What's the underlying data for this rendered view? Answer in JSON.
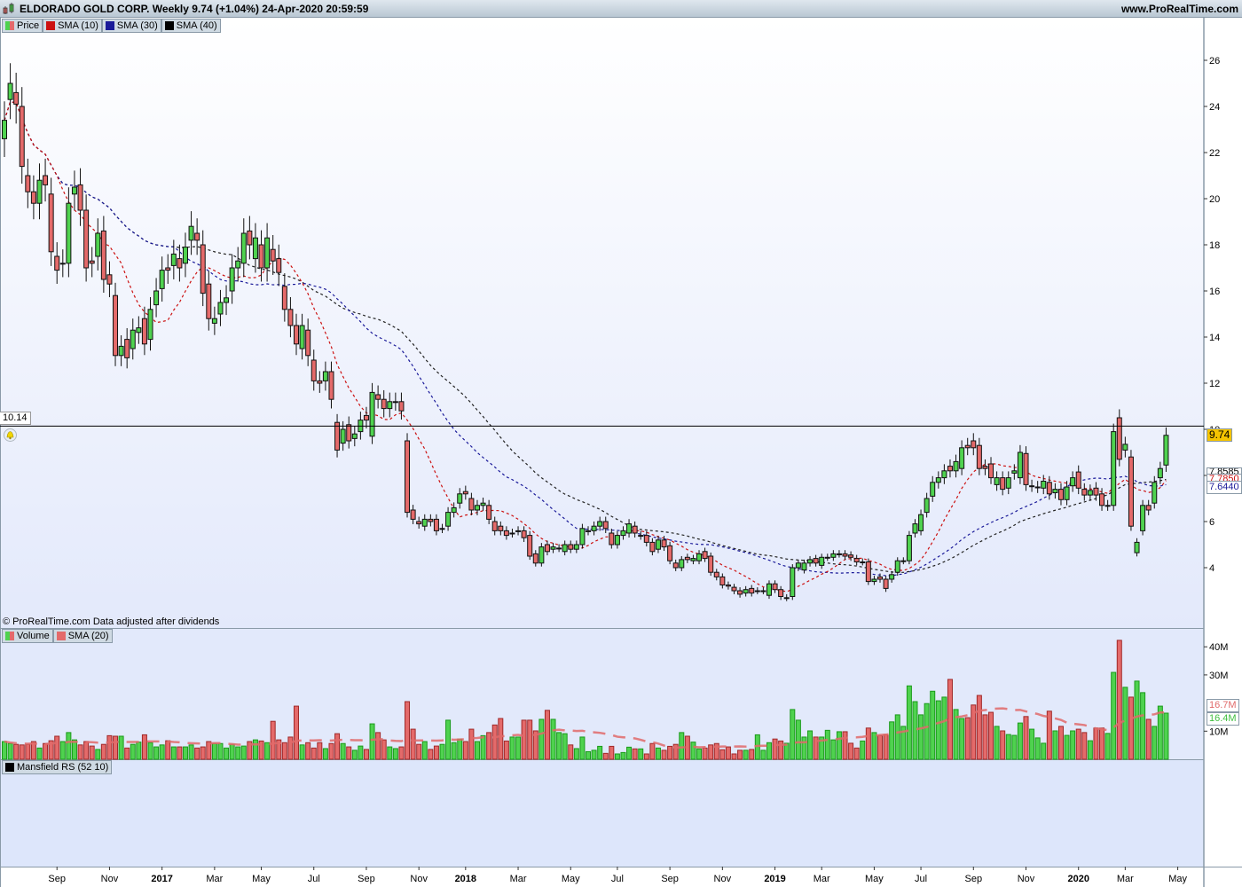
{
  "header": {
    "title": "ELDORADO GOLD CORP. Weekly 9.74 (+1.04%) 24-Apr-2020 20:59:59",
    "site": "www.ProRealTime.com"
  },
  "price_legend": [
    "Price",
    "SMA (10)",
    "SMA (30)",
    "SMA (40)"
  ],
  "volume_legend": [
    "Volume",
    "SMA (20)"
  ],
  "rs_legend": [
    "Mansfield RS (52 10)"
  ],
  "footnote": "© ProRealTime.com  Data adjusted after dividends",
  "colors": {
    "up": "#4fd24f",
    "down": "#e46a6a",
    "sma10": "#cc1111",
    "sma30": "#1a1a99",
    "sma40": "#222222",
    "vol_sma": "#e06a6a",
    "last_price_bg": "#f5c400"
  },
  "markers": {
    "line_value": "10.14",
    "last_price": "9.74",
    "sma40_last": "7.8585",
    "sma10_last": "7.7850",
    "sma30_last": "7.6440",
    "vol_sma_last": "16.7M",
    "vol_last": "16.4M"
  },
  "chart_data": {
    "type": "candlestick",
    "title": "ELDORADO GOLD CORP. Weekly",
    "price_axis": {
      "ticks": [
        4,
        6,
        8,
        10,
        12,
        14,
        16,
        18,
        20,
        22,
        24,
        26
      ],
      "ylim": [
        1.5,
        27.8
      ]
    },
    "volume_axis": {
      "ticks": [
        {
          "v": 10,
          "label": "10M"
        },
        {
          "v": 30,
          "label": "30M"
        },
        {
          "v": 40,
          "label": "40M"
        }
      ],
      "unit": "M"
    },
    "x_ticks": [
      {
        "week": 9,
        "label": "Sep"
      },
      {
        "week": 18,
        "label": "Nov"
      },
      {
        "week": 27,
        "label": "2017",
        "bold": true
      },
      {
        "week": 36,
        "label": "Mar"
      },
      {
        "week": 44,
        "label": "May"
      },
      {
        "week": 53,
        "label": "Jul"
      },
      {
        "week": 62,
        "label": "Sep"
      },
      {
        "week": 71,
        "label": "Nov"
      },
      {
        "week": 79,
        "label": "2018",
        "bold": true
      },
      {
        "week": 88,
        "label": "Mar"
      },
      {
        "week": 97,
        "label": "May"
      },
      {
        "week": 105,
        "label": "Jul"
      },
      {
        "week": 114,
        "label": "Sep"
      },
      {
        "week": 123,
        "label": "Nov"
      },
      {
        "week": 132,
        "label": "2019",
        "bold": true
      },
      {
        "week": 140,
        "label": "Mar"
      },
      {
        "week": 149,
        "label": "May"
      },
      {
        "week": 157,
        "label": "Jul"
      },
      {
        "week": 166,
        "label": "Sep"
      },
      {
        "week": 175,
        "label": "Nov"
      },
      {
        "week": 184,
        "label": "2020",
        "bold": true
      },
      {
        "week": 192,
        "label": "Mar"
      },
      {
        "week": 201,
        "label": "May"
      }
    ],
    "candles_open_close": [
      [
        22.6,
        23.4
      ],
      [
        24.3,
        25.0
      ],
      [
        24.6,
        24.1
      ],
      [
        24.0,
        21.4
      ],
      [
        21.0,
        20.3
      ],
      [
        20.3,
        19.8
      ],
      [
        19.8,
        20.8
      ],
      [
        21.0,
        20.6
      ],
      [
        20.2,
        17.7
      ],
      [
        17.5,
        16.9
      ],
      [
        17.2,
        17.2
      ],
      [
        17.2,
        19.8
      ],
      [
        20.2,
        20.5
      ],
      [
        20.6,
        19.5
      ],
      [
        19.5,
        17.0
      ],
      [
        17.3,
        17.2
      ],
      [
        17.5,
        18.5
      ],
      [
        18.6,
        16.5
      ],
      [
        16.7,
        16.3
      ],
      [
        15.8,
        13.2
      ],
      [
        13.2,
        13.6
      ],
      [
        13.9,
        13.1
      ],
      [
        13.5,
        14.3
      ],
      [
        14.2,
        14.4
      ],
      [
        14.8,
        13.7
      ],
      [
        13.9,
        15.2
      ],
      [
        15.4,
        16.0
      ],
      [
        16.1,
        16.9
      ],
      [
        17.0,
        16.9
      ],
      [
        17.1,
        17.6
      ],
      [
        17.4,
        17.0
      ],
      [
        17.2,
        17.9
      ],
      [
        18.2,
        18.8
      ],
      [
        18.5,
        18.2
      ],
      [
        18.0,
        15.9
      ],
      [
        16.3,
        14.8
      ],
      [
        14.6,
        14.8
      ],
      [
        15.0,
        15.5
      ],
      [
        15.5,
        15.7
      ],
      [
        16.0,
        17.0
      ],
      [
        17.0,
        17.3
      ],
      [
        17.2,
        18.5
      ],
      [
        18.6,
        18.0
      ],
      [
        17.4,
        18.3
      ],
      [
        18.0,
        17.0
      ],
      [
        17.0,
        18.3
      ],
      [
        17.8,
        17.3
      ],
      [
        17.4,
        16.8
      ],
      [
        16.2,
        15.2
      ],
      [
        15.2,
        14.5
      ],
      [
        14.5,
        13.7
      ],
      [
        13.5,
        14.5
      ],
      [
        14.3,
        13.2
      ],
      [
        13.0,
        12.1
      ],
      [
        12.1,
        12.0
      ],
      [
        12.1,
        12.5
      ],
      [
        12.5,
        11.3
      ],
      [
        10.3,
        9.1
      ],
      [
        9.4,
        10.0
      ],
      [
        10.2,
        9.5
      ],
      [
        9.6,
        9.8
      ],
      [
        9.9,
        10.4
      ],
      [
        10.6,
        10.4
      ],
      [
        9.7,
        11.6
      ],
      [
        11.5,
        11.3
      ],
      [
        11.3,
        10.9
      ],
      [
        10.9,
        11.2
      ],
      [
        11.2,
        11.2
      ],
      [
        11.2,
        10.8
      ],
      [
        9.5,
        6.4
      ],
      [
        6.5,
        6.1
      ],
      [
        6.0,
        5.9
      ],
      [
        5.8,
        6.1
      ],
      [
        6.1,
        6.0
      ],
      [
        6.1,
        5.6
      ],
      [
        5.7,
        5.7
      ],
      [
        5.8,
        6.4
      ],
      [
        6.4,
        6.6
      ],
      [
        6.8,
        7.2
      ],
      [
        7.3,
        7.2
      ],
      [
        7.0,
        6.5
      ],
      [
        6.5,
        6.7
      ],
      [
        6.7,
        6.8
      ],
      [
        6.7,
        6.1
      ],
      [
        6.0,
        5.6
      ],
      [
        5.8,
        5.6
      ],
      [
        5.6,
        5.4
      ],
      [
        5.5,
        5.5
      ],
      [
        5.6,
        5.6
      ],
      [
        5.6,
        5.3
      ],
      [
        5.4,
        4.5
      ],
      [
        4.6,
        4.2
      ],
      [
        4.2,
        4.9
      ],
      [
        5.0,
        4.7
      ],
      [
        4.8,
        4.9
      ],
      [
        4.85,
        4.85
      ],
      [
        4.7,
        5.0
      ],
      [
        5.0,
        4.8
      ],
      [
        4.8,
        5.0
      ],
      [
        5.0,
        5.7
      ],
      [
        5.6,
        5.6
      ],
      [
        5.6,
        5.8
      ],
      [
        5.8,
        6.0
      ],
      [
        6.0,
        5.7
      ],
      [
        5.5,
        5.0
      ],
      [
        5.0,
        5.4
      ],
      [
        5.4,
        5.6
      ],
      [
        5.5,
        5.9
      ],
      [
        5.8,
        5.5
      ],
      [
        5.4,
        5.4
      ],
      [
        5.4,
        5.1
      ],
      [
        5.1,
        4.7
      ],
      [
        4.8,
        5.2
      ],
      [
        5.2,
        4.9
      ],
      [
        4.95,
        4.3
      ],
      [
        4.2,
        4.0
      ],
      [
        4.0,
        4.35
      ],
      [
        4.45,
        4.35
      ],
      [
        4.3,
        4.4
      ],
      [
        4.3,
        4.6
      ],
      [
        4.7,
        4.4
      ],
      [
        4.5,
        3.8
      ],
      [
        3.8,
        3.6
      ],
      [
        3.6,
        3.25
      ],
      [
        3.25,
        3.2
      ],
      [
        3.15,
        3.0
      ],
      [
        3.0,
        2.85
      ],
      [
        2.9,
        3.05
      ],
      [
        3.1,
        2.9
      ],
      [
        3.0,
        3.0
      ],
      [
        3.0,
        3.0
      ],
      [
        2.8,
        3.3
      ],
      [
        3.3,
        3.05
      ],
      [
        3.05,
        2.75
      ],
      [
        2.7,
        2.7
      ],
      [
        2.75,
        4.0
      ],
      [
        4.0,
        4.2
      ],
      [
        3.9,
        4.2
      ],
      [
        4.2,
        4.35
      ],
      [
        4.4,
        4.2
      ],
      [
        4.1,
        4.45
      ],
      [
        4.45,
        4.45
      ],
      [
        4.45,
        4.6
      ],
      [
        4.6,
        4.6
      ],
      [
        4.6,
        4.5
      ],
      [
        4.55,
        4.45
      ],
      [
        4.4,
        4.25
      ],
      [
        4.25,
        4.25
      ],
      [
        4.25,
        3.4
      ],
      [
        3.4,
        3.5
      ],
      [
        3.6,
        3.5
      ],
      [
        3.5,
        3.1
      ],
      [
        3.5,
        3.7
      ],
      [
        3.8,
        4.3
      ],
      [
        4.3,
        4.3
      ],
      [
        4.3,
        5.4
      ],
      [
        5.5,
        5.9
      ],
      [
        5.6,
        6.3
      ],
      [
        6.4,
        7.0
      ],
      [
        7.1,
        7.7
      ],
      [
        7.7,
        7.9
      ],
      [
        7.9,
        8.2
      ],
      [
        8.4,
        8.2
      ],
      [
        8.2,
        8.6
      ],
      [
        8.3,
        9.2
      ],
      [
        9.3,
        9.2
      ],
      [
        9.5,
        9.2
      ],
      [
        9.3,
        8.3
      ],
      [
        8.4,
        8.3
      ],
      [
        8.5,
        7.9
      ],
      [
        7.6,
        7.9
      ],
      [
        7.9,
        7.4
      ],
      [
        7.45,
        7.9
      ],
      [
        8.1,
        8.2
      ],
      [
        7.9,
        9.0
      ],
      [
        8.95,
        7.6
      ],
      [
        7.55,
        7.55
      ],
      [
        7.5,
        7.5
      ],
      [
        7.45,
        7.75
      ],
      [
        7.7,
        7.2
      ],
      [
        7.25,
        7.4
      ],
      [
        7.4,
        6.95
      ],
      [
        6.95,
        7.5
      ],
      [
        7.55,
        7.9
      ],
      [
        8.15,
        7.45
      ],
      [
        7.4,
        7.15
      ],
      [
        7.15,
        7.35
      ],
      [
        7.45,
        7.15
      ],
      [
        7.2,
        6.7
      ],
      [
        6.7,
        6.7
      ],
      [
        6.7,
        9.9
      ],
      [
        10.5,
        8.7
      ],
      [
        9.1,
        9.35
      ],
      [
        8.8,
        5.8
      ],
      [
        4.65,
        5.1
      ],
      [
        5.6,
        6.7
      ],
      [
        6.7,
        6.5
      ],
      [
        6.8,
        7.7
      ],
      [
        7.9,
        8.3
      ],
      [
        8.45,
        9.74
      ]
    ],
    "volume_millions": [
      6.3,
      5.6,
      5.3,
      5.1,
      5.3,
      6.3,
      4.0,
      5.6,
      6.6,
      8.2,
      6.3,
      9.5,
      6.9,
      5.1,
      6.3,
      4.7,
      3.5,
      5.3,
      8.4,
      8.2,
      8.2,
      4.0,
      5.3,
      6.1,
      8.7,
      5.9,
      4.4,
      5.1,
      6.6,
      4.4,
      4.4,
      4.4,
      5.1,
      4.0,
      4.4,
      6.3,
      5.6,
      5.6,
      4.0,
      5.3,
      4.4,
      4.7,
      6.3,
      6.9,
      6.5,
      5.9,
      13.5,
      6.9,
      5.9,
      7.9,
      18.9,
      5.1,
      5.9,
      4.0,
      5.9,
      3.8,
      5.6,
      9.1,
      5.6,
      4.4,
      3.2,
      4.7,
      3.5,
      12.6,
      9.5,
      6.9,
      4.4,
      3.8,
      4.4,
      20.5,
      10.7,
      5.3,
      6.3,
      3.5,
      4.7,
      5.3,
      13.9,
      5.9,
      7.2,
      6.3,
      10.7,
      6.3,
      8.4,
      9.5,
      12.2,
      14.5,
      6.5,
      7.9,
      7.9,
      13.9,
      13.9,
      10.1,
      14.2,
      17.4,
      14.2,
      9.5,
      9.1,
      5.1,
      3.8,
      7.9,
      2.7,
      3.2,
      4.6,
      2.1,
      4.6,
      1.9,
      2.4,
      4.3,
      3.7,
      3.7,
      1.9,
      5.6,
      4.0,
      3.2,
      4.6,
      5.3,
      9.5,
      8.2,
      6.1,
      3.7,
      4.0,
      5.1,
      5.6,
      3.4,
      4.4,
      1.9,
      3.2,
      3.2,
      3.5,
      8.7,
      3.2,
      5.9,
      7.2,
      6.5,
      5.7,
      17.7,
      13.9,
      7.9,
      10.1,
      7.9,
      7.9,
      10.3,
      6.9,
      9.8,
      9.8,
      5.7,
      4.0,
      6.5,
      11.1,
      9.5,
      8.4,
      8.7,
      13.3,
      15.8,
      11.7,
      26.1,
      20.5,
      15.8,
      19.8,
      24.2,
      20.8,
      22.1,
      28.4,
      17.7,
      14.5,
      14.8,
      19.3,
      22.7,
      15.8,
      16.7,
      11.7,
      10.1,
      8.8,
      8.5,
      12.9,
      15.2,
      10.7,
      7.6,
      5.7,
      17.1,
      10.1,
      11.7,
      8.5,
      10.1,
      10.7,
      9.5,
      6.6,
      11.1,
      11.1,
      9.2,
      30.9,
      42.3,
      25.6,
      22.1,
      27.8,
      23.7,
      14.2,
      11.7,
      18.9,
      16.4
    ]
  }
}
